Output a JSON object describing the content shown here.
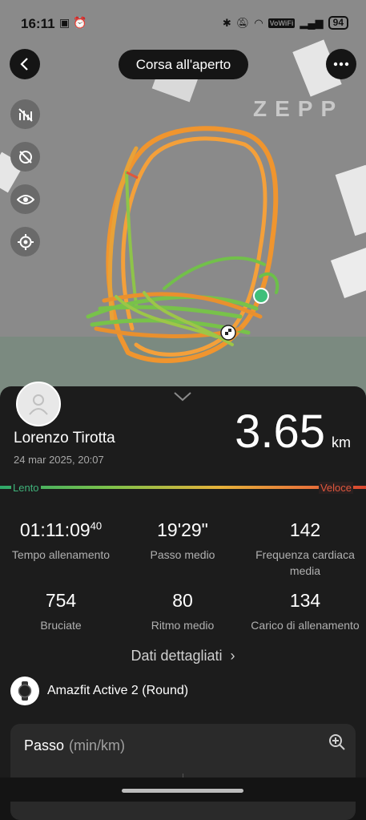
{
  "status": {
    "time": "16:11",
    "vowifi": "VoWiFi",
    "battery": "94"
  },
  "header": {
    "title": "Corsa all'aperto"
  },
  "map": {
    "watermark": "ZEPP"
  },
  "user": {
    "name": "Lorenzo Tirotta",
    "datetime": "24 mar 2025, 20:07"
  },
  "summary": {
    "distance": "3.65",
    "distance_unit": "km"
  },
  "pace_scale": {
    "slow_label": "Lento",
    "fast_label": "Veloce"
  },
  "stats": [
    {
      "value": "01:11:09",
      "value_sup": "40",
      "label": "Tempo allenamento"
    },
    {
      "value": "19'29\"",
      "label": "Passo medio"
    },
    {
      "value": "142",
      "label": "Frequenza cardiaca media"
    },
    {
      "value": "754",
      "label": "Bruciate"
    },
    {
      "value": "80",
      "label": "Ritmo medio"
    },
    {
      "value": "134",
      "label": "Carico di allenamento"
    }
  ],
  "details_link": {
    "label": "Dati dettagliati"
  },
  "device": {
    "name": "Amazfit Active 2 (Round)"
  },
  "pace_card": {
    "title": "Passo",
    "unit": "(min/km)"
  },
  "colors": {
    "route_fast": "#f0952e",
    "route_slow": "#6cc04a",
    "accent": "#e0563c"
  }
}
